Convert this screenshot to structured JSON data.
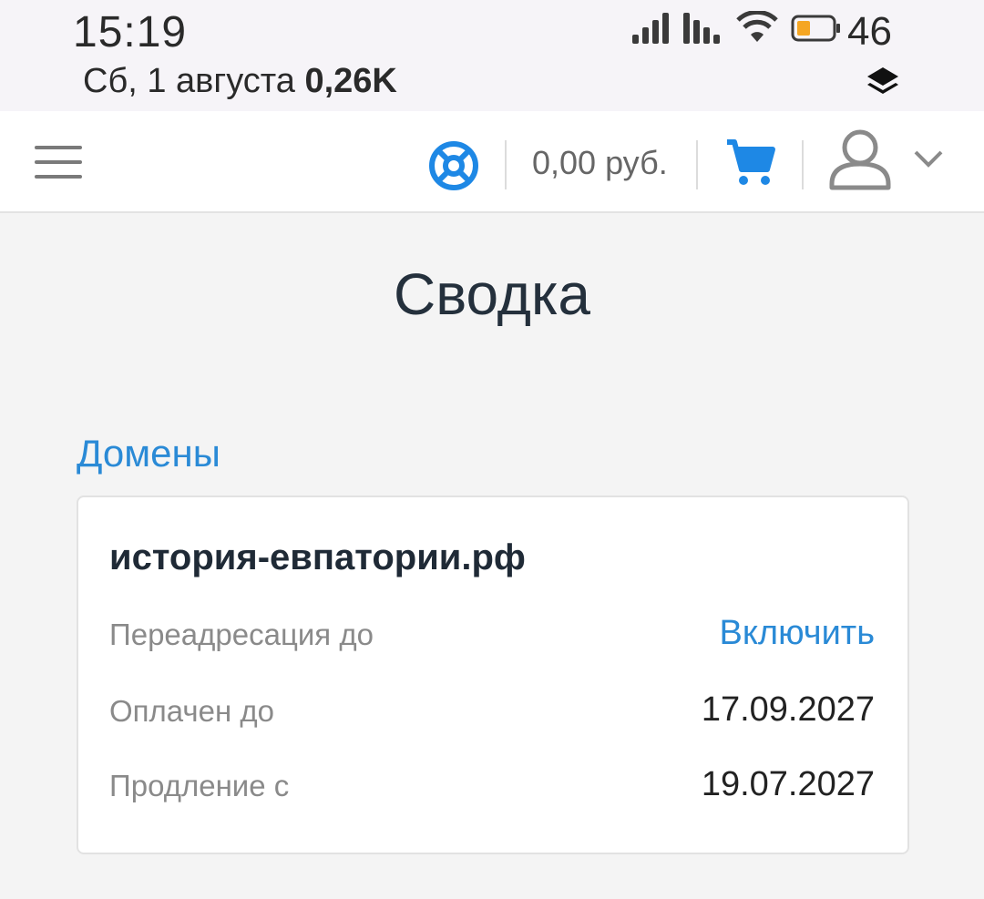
{
  "status_bar": {
    "time": "15:19",
    "date": "Сб, 1 августа",
    "data_speed": "0,26K",
    "battery": "46",
    "icons": [
      "signal-icon",
      "signal-icon-2",
      "wifi-icon",
      "battery-icon",
      "layers-icon"
    ]
  },
  "header": {
    "balance": "0,00 руб.",
    "icons": [
      "menu-icon",
      "help-icon",
      "cart-icon",
      "user-icon",
      "chevron-down-icon"
    ],
    "accent": "#1e88e5"
  },
  "page": {
    "title": "Сводка",
    "section_title": "Домены"
  },
  "domain_card": {
    "name": "история-евпатории.рф",
    "rows": [
      {
        "label": "Переадресация до",
        "value": "Включить"
      },
      {
        "label": "Оплачен до",
        "value": "17.09.2027"
      },
      {
        "label": "Продление с",
        "value": "19.07.2027"
      }
    ]
  },
  "colors": {
    "link": "#2a8ad6",
    "title": "#24303c",
    "background": "#f4f4f4"
  }
}
